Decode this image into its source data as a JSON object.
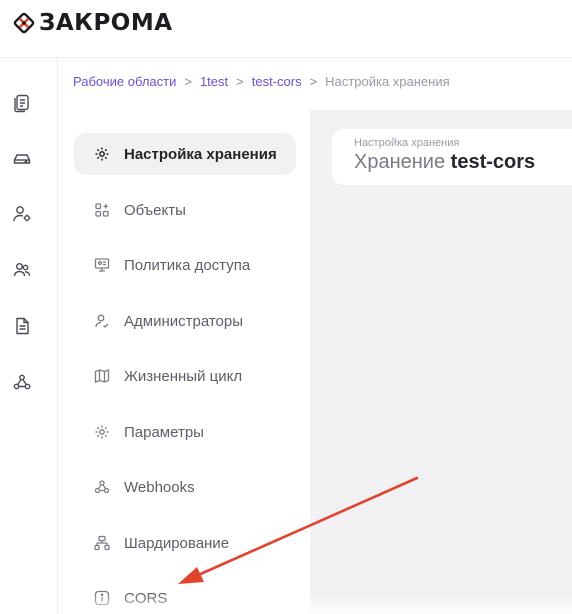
{
  "brand": {
    "name": "ЗАКРОМА",
    "accent": "#e2432a"
  },
  "rail": {
    "icons": [
      "documents-icon",
      "storage-icon",
      "user-settings-icon",
      "users-icon",
      "file-icon",
      "webhook-icon"
    ]
  },
  "breadcrumb": {
    "items": [
      "Рабочие области",
      "1test",
      "test-cors"
    ],
    "separator": ">",
    "current": "Настройка хранения"
  },
  "menu": {
    "items": [
      {
        "label": "Настройка хранения",
        "icon": "gear-icon",
        "active": true
      },
      {
        "label": "Объекты",
        "icon": "objects-grid-icon",
        "active": false
      },
      {
        "label": "Политика доступа",
        "icon": "access-policy-icon",
        "active": false
      },
      {
        "label": "Администраторы",
        "icon": "admin-user-icon",
        "active": false
      },
      {
        "label": "Жизненный цикл",
        "icon": "map-icon",
        "active": false
      },
      {
        "label": "Параметры",
        "icon": "gear-icon",
        "active": false
      },
      {
        "label": "Webhooks",
        "icon": "webhook-icon",
        "active": false
      },
      {
        "label": "Шардирование",
        "icon": "sharding-icon",
        "active": false
      },
      {
        "label": "CORS",
        "icon": "info-icon",
        "active": false
      }
    ]
  },
  "header": {
    "subtitle": "Настройка хранения",
    "title_prefix": "Хранение",
    "title_name": "test-cors"
  },
  "annotation": {
    "type": "arrow",
    "color": "#e2432a",
    "target": "CORS"
  }
}
